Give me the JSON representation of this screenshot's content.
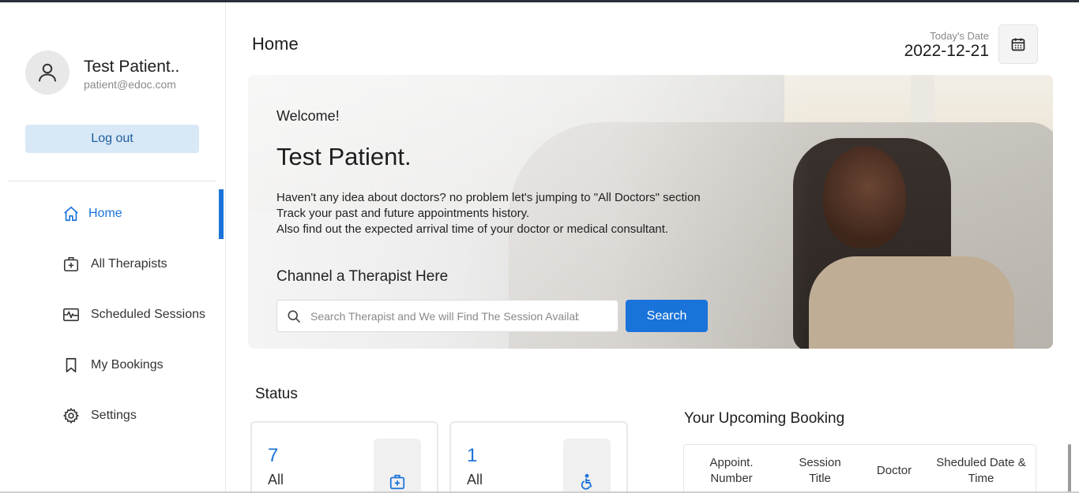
{
  "profile": {
    "name": "Test Patient..",
    "email": "patient@edoc.com",
    "logout_label": "Log out"
  },
  "sidebar": {
    "items": [
      {
        "label": "Home",
        "icon": "home-icon",
        "active": true
      },
      {
        "label": "All Therapists",
        "icon": "medical-kit-icon",
        "active": false
      },
      {
        "label": "Scheduled Sessions",
        "icon": "heartbeat-icon",
        "active": false
      },
      {
        "label": "My Bookings",
        "icon": "bookmark-icon",
        "active": false
      },
      {
        "label": "Settings",
        "icon": "gear-icon",
        "active": false
      }
    ]
  },
  "header": {
    "title": "Home",
    "date_label": "Today's Date",
    "date_value": "2022-12-21"
  },
  "hero": {
    "welcome": "Welcome!",
    "name": "Test Patient.",
    "description": [
      "Haven't any idea about doctors? no problem let's jumping to \"All Doctors\" section",
      "Track your past and future appointments history.",
      "Also find out the expected arrival time of your doctor or medical consultant."
    ],
    "channel_label": "Channel a Therapist Here",
    "search_placeholder": "Search Therapist and We will Find The Session Available",
    "search_button": "Search"
  },
  "status": {
    "title": "Status",
    "cards": [
      {
        "count": "7",
        "label": "All",
        "icon": "medical-kit-icon"
      },
      {
        "count": "1",
        "label": "All",
        "icon": "wheelchair-icon"
      }
    ]
  },
  "upcoming": {
    "title": "Your Upcoming Booking",
    "columns": [
      "Appoint. Number",
      "Session Title",
      "Doctor",
      "Sheduled Date & Time"
    ]
  },
  "colors": {
    "accent": "#1a73d9",
    "logout_bg": "#d8e8f7"
  }
}
